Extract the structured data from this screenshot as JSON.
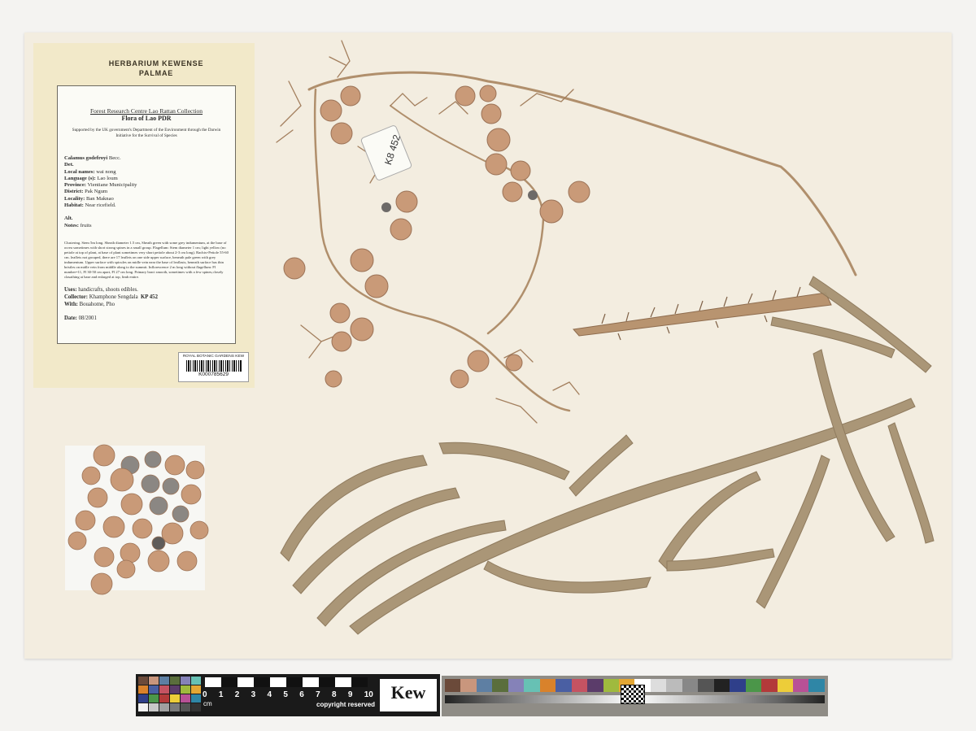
{
  "folder": {
    "herbarium": "HERBARIUM KEWENSE",
    "family": "PALMAE"
  },
  "label": {
    "collection": "Forest Research Centre Lao Rattan Collection",
    "flora": "Flora of Lao PDR",
    "support": "Supported by the UK government's Department of the Environment through the Darwin Initiative for the Survival of Species",
    "fields": [
      {
        "key": "Calamus godefroyi",
        "value": "Becc."
      },
      {
        "key": "Det.",
        "value": ""
      },
      {
        "key": "Local names:",
        "value": "wai nong"
      },
      {
        "key": "Language (s):",
        "value": "Lao loum"
      },
      {
        "key": "Province:",
        "value": "Vientiane Municipality"
      },
      {
        "key": "District:",
        "value": "Pak Ngum"
      },
      {
        "key": "Locality:",
        "value": "Ban Maknao"
      },
      {
        "key": "Habitat:",
        "value": "Near ricefield."
      }
    ],
    "alt": "Alt.",
    "notes_key": "Notes:",
    "notes_value": "fruits",
    "description": "Clustering. Stem 5m long. Sheath diameter 1.5 cm, Sheath green with some grey indumentum, at the base of ocrea sometimes with short strong spines in a small group. Flagellum: Stem diameter 1 cm; light yellow (no petiole at top of plant, at base of plant sometimes very short petiole about 2-3 cm long). Rachis+Petiole 55-60 cm. leaflets not grouped, there are 17 leaflets on one side upper surface, beneath pale green with grey indumentum. Upper surface with spicules on midle vein near the base of leaflasts, beneath surface has thin bristles on midle vein from middle along to the summit. Inflorescence 2 m long without flagellum: Fl number=11, Fl 30-50 cm apart, Fl 27 cm long. Primary bract smooth, sometimes with a few spines,closely clasathing at base and enlarged at top, limb entire.",
    "uses_key": "Uses:",
    "uses_value": "handicrafts, shoots edibles.",
    "collector_key": "Collector:",
    "collector_value": "Khamphone Sengdala",
    "collector_number": "KP 452",
    "with_key": "With:",
    "with_value": "Bouahome, Pho",
    "date_key": "Date:",
    "date_value": "08/2001"
  },
  "barcode": {
    "institution": "ROYAL BOTANIC GARDENS KEW",
    "number": "K000785629"
  },
  "tag": {
    "text": "K8 452"
  },
  "scale": {
    "numbers": [
      "0",
      "1",
      "2",
      "3",
      "4",
      "5",
      "6",
      "7",
      "8",
      "9",
      "10"
    ],
    "unit": "cm",
    "copyright": "copyright reserved",
    "logo": "Kew"
  },
  "colors": {
    "sheet": "#f3ede0",
    "folder": "#f2e9c9",
    "stem": "#b08f6c",
    "fruit": "#c99a78",
    "leaf": "#a79272",
    "background": "#f4f3f1"
  }
}
